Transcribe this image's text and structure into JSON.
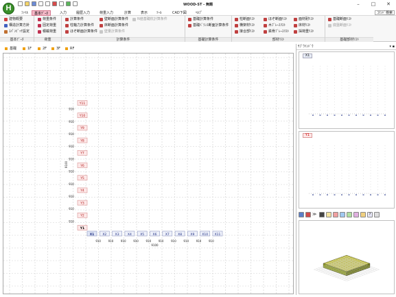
{
  "window": {
    "title": "WOOD-ST - 無題",
    "logo_text": "H",
    "minimize": "–",
    "maximize": "□",
    "close": "✕"
  },
  "menu": {
    "items": [
      "ﾌｧｲﾙ",
      "基本ﾃﾞｰﾀ",
      "入力",
      "履歴入力",
      "荷重入力",
      "計算",
      "表示",
      "ﾂｰﾙ",
      "CAD下図",
      "ﾍﾙﾌﾟ"
    ],
    "active_index": 1,
    "command_search": "ｺﾏﾝﾄﾞ検索"
  },
  "ribbon": {
    "groups": [
      {
        "label": "基本ﾃﾞｰﾀ",
        "buttons": [
          "建物概要",
          "構造計算方針",
          "ｽﾊﾟﾝﾋﾟｯﾁ設定"
        ]
      },
      {
        "label": "荷重",
        "buttons": [
          "荷重条件",
          "固定荷重",
          "積載荷重"
        ]
      },
      {
        "label": "計算条件",
        "buttons": [
          "計算条件",
          "柱軸力計算条件",
          "ほぞ断面計算条件",
          "壁断面計算条件",
          "床断面計算条件",
          "壁量計算条件",
          "N値基礎杭計算条件"
        ]
      },
      {
        "label": "基礎計算条件",
        "buttons": [
          "基礎計算条件",
          "基礎ﾊﾞﾗﾝｽ断面計算条件"
        ]
      },
      {
        "label": "部材ﾘｽﾄ",
        "buttons": [
          "柱断面ﾘｽﾄ",
          "横架材ﾘｽﾄ",
          "接合部ﾘｽﾄ",
          "ほぞ断面ﾘｽﾄ",
          "木ﾌﾞﾚｰｽﾘｽﾄ",
          "鉄骨ﾌﾞﾚｰｽﾘｽﾄ",
          "面材耐ﾘｽﾄ",
          "床材ﾘｽﾄ",
          "採荷重ﾘｽﾄ"
        ]
      },
      {
        "label": "基礎部材ﾘｽﾄ",
        "buttons": [
          "基礎断面ﾘｽﾄ",
          "底盤断面ﾘｽﾄ"
        ]
      }
    ]
  },
  "floor_tabs": [
    "基礎",
    "1F",
    "2F",
    "3F",
    "RF"
  ],
  "floor_active": "1F",
  "plan": {
    "x_axes": [
      "X1",
      "X2",
      "X3",
      "X4",
      "X5",
      "X6",
      "X7",
      "X8",
      "X9",
      "X10",
      "X11"
    ],
    "y_axes": [
      "Y11",
      "Y10",
      "Y9",
      "Y8",
      "Y7",
      "Y6",
      "Y5",
      "Y4",
      "Y3",
      "Y2",
      "Y1"
    ],
    "span_label": "910",
    "total_x": "9100",
    "total_y": "9100"
  },
  "sub_window": {
    "title": "ｻﾌﾞｳｲﾝﾄﾞｳ",
    "controls": "▾ ▪",
    "panel1_tag": "X1",
    "panel2_tag": "Y1"
  },
  "icons": [
    "panel-icon",
    "view-icon",
    "arrow-icon",
    "tool-icon",
    "grid-icon",
    "color-icon",
    "color2-icon",
    "color3-icon",
    "color4-icon",
    "color5-icon",
    "help-icon",
    "settings-icon"
  ]
}
